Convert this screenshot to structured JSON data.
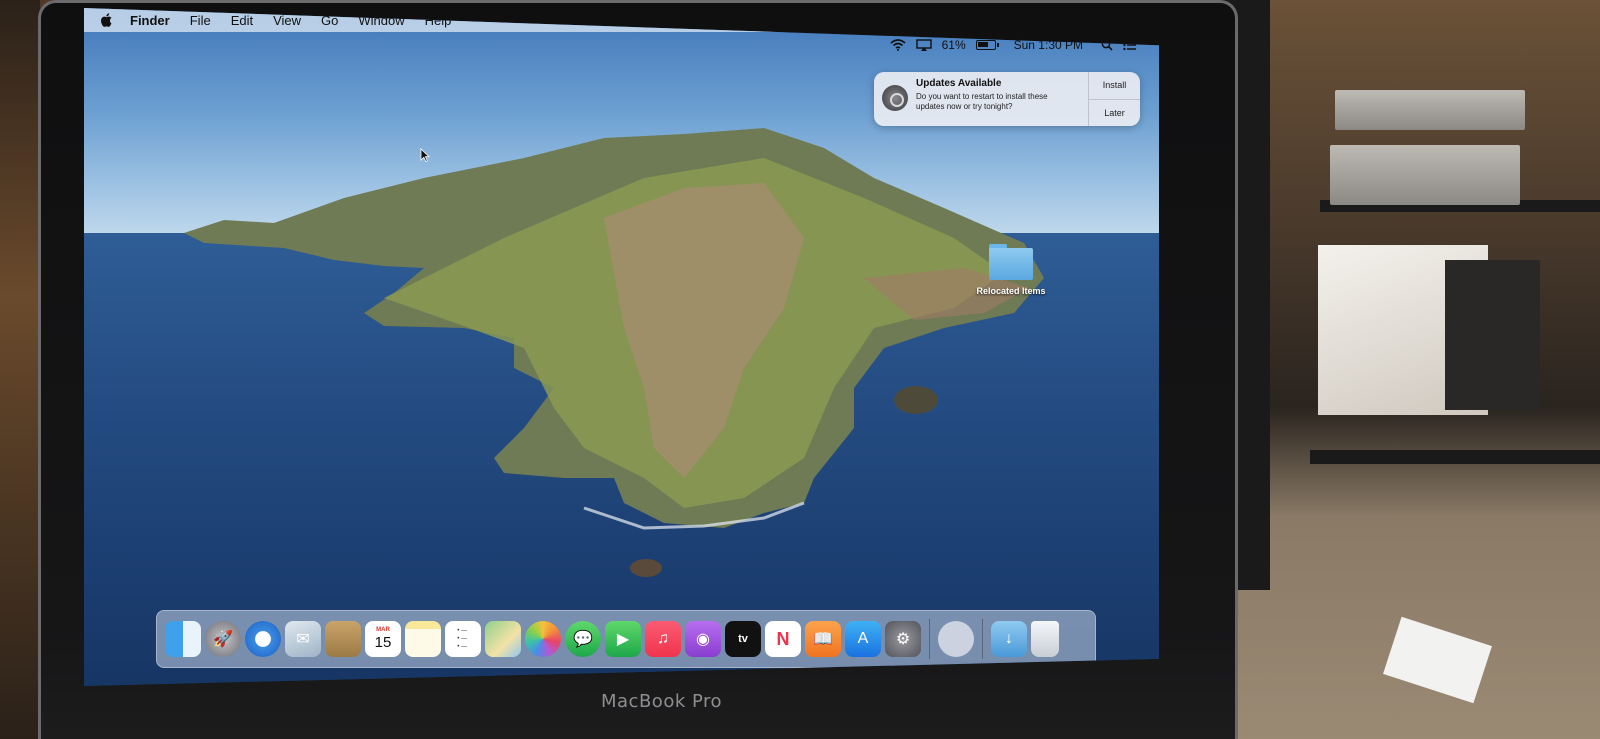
{
  "menubar": {
    "app_name": "Finder",
    "items": [
      "File",
      "Edit",
      "View",
      "Go",
      "Window",
      "Help"
    ],
    "battery_percent": "61%",
    "clock": "Sun 1:30 PM"
  },
  "notification": {
    "title": "Updates Available",
    "message": "Do you want to restart to install these updates now or try tonight?",
    "install_label": "Install",
    "later_label": "Later"
  },
  "desktop": {
    "folder_label": "Relocated Items"
  },
  "dock": {
    "items": [
      "Finder",
      "Launchpad",
      "Safari",
      "Mail",
      "Contacts",
      "Calendar",
      "Notes",
      "Reminders",
      "Maps",
      "Photos",
      "Messages",
      "FaceTime",
      "Music",
      "Podcasts",
      "TV",
      "News",
      "Books",
      "App Store",
      "System Preferences",
      "AirDrop",
      "Downloads",
      "Trash"
    ],
    "calendar_month": "MAR",
    "calendar_day": "15",
    "tv_label": "tv"
  },
  "device": {
    "brand_label": "MacBook Pro"
  },
  "colors": {
    "menubar_bg": "#d2e1f0",
    "sky_top": "#3f76b9",
    "sea": "#1c3f72",
    "notification_bg": "#e8ecf2",
    "folder_blue": "#5aa8e0"
  }
}
